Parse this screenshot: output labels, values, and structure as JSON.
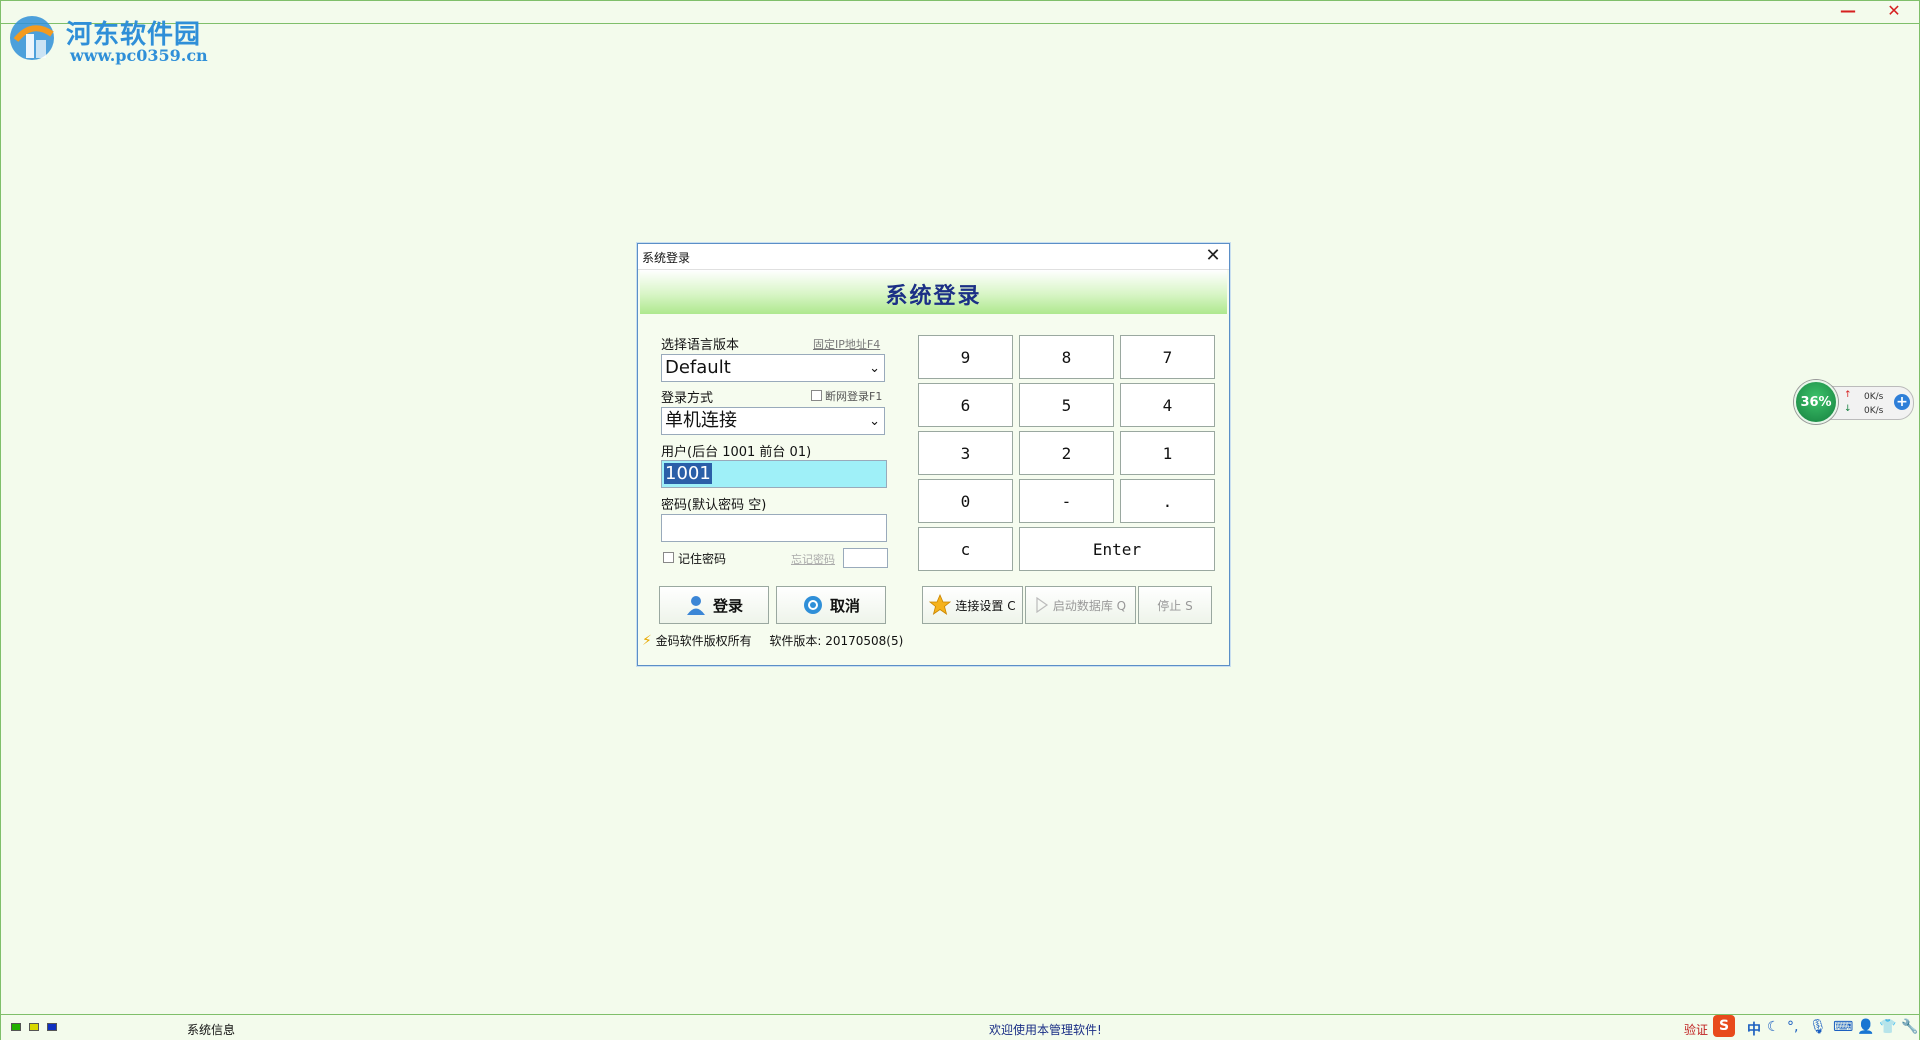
{
  "watermark": {
    "name": "河东软件园",
    "url": "www.pc0359.cn"
  },
  "window_controls": {
    "minimize": "—",
    "close": "✕"
  },
  "dialog": {
    "title": "系统登录",
    "heading": "系统登录",
    "close_glyph": "✕",
    "language": {
      "label": "选择语言版本",
      "fixed_ip_link": "固定IP地址F4",
      "value": "Default"
    },
    "login_mode": {
      "label": "登录方式",
      "offline_label": "断网登录F1",
      "value": "单机连接"
    },
    "user": {
      "label": "用户(后台 1001 前台 01)",
      "value": "1001"
    },
    "password": {
      "label": "密码(默认密码 空)",
      "value": ""
    },
    "remember": {
      "label": "记住密码",
      "forgot_link": "忘记密码"
    },
    "buttons": {
      "login": "登录",
      "cancel": "取消"
    },
    "keypad": {
      "row1": [
        "9",
        "8",
        "7"
      ],
      "row2": [
        "6",
        "5",
        "4"
      ],
      "row3": [
        "3",
        "2",
        "1"
      ],
      "row4": [
        "0",
        "-",
        "."
      ],
      "clear": "c",
      "enter": "Enter"
    },
    "tools": {
      "connect": "连接设置 C",
      "start_db": "启动数据库 Q",
      "stop": "停止 S"
    },
    "footer": {
      "copyright": "金码软件版权所有",
      "version": "软件版本: 20170508(5)"
    }
  },
  "net_widget": {
    "percent": "36%",
    "up": "0K/s",
    "down": "0K/s"
  },
  "statusbar": {
    "info": "系统信息",
    "welcome": "欢迎使用本管理软件!",
    "verify": "验证",
    "ime": "中",
    "led_colors": [
      "#22b000",
      "#d8d800",
      "#1030c0"
    ]
  }
}
